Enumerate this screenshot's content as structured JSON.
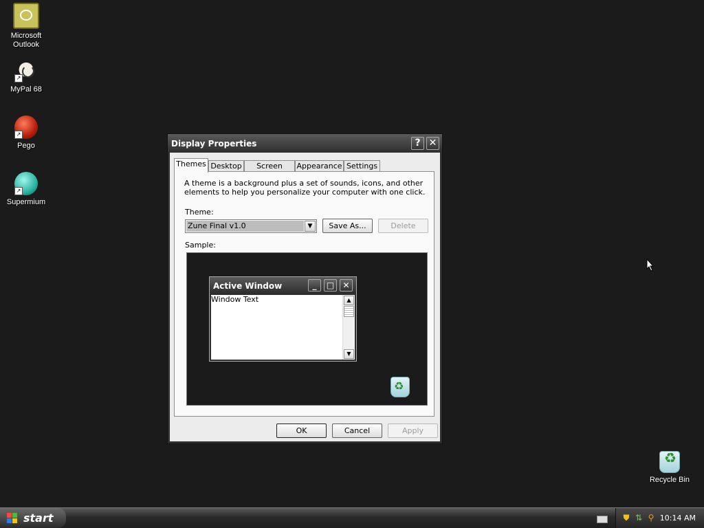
{
  "desktop": {
    "icons": [
      {
        "label": "Microsoft Outlook",
        "icon": "outlook-icon"
      },
      {
        "label": "MyPal 68",
        "icon": "mypal-icon"
      },
      {
        "label": "Pego",
        "icon": "pego-icon"
      },
      {
        "label": "Supermium",
        "icon": "supermium-icon"
      },
      {
        "label": "Recycle Bin",
        "icon": "recycle-bin-icon"
      }
    ]
  },
  "dialog": {
    "title": "Display Properties",
    "help_glyph": "?",
    "close_glyph": "✕",
    "tabs": [
      "Themes",
      "Desktop",
      "Screen Saver",
      "Appearance",
      "Settings"
    ],
    "active_tab": "Themes",
    "description": "A theme is a background plus a set of sounds, icons, and other elements to help you personalize your computer with one click.",
    "theme_label": "Theme:",
    "theme_value": "Zune Final v1.0",
    "save_as_label": "Save As...",
    "delete_label": "Delete",
    "sample_label": "Sample:",
    "sample": {
      "window_title": "Active Window",
      "window_text": "Window Text"
    },
    "ok_label": "OK",
    "cancel_label": "Cancel",
    "apply_label": "Apply"
  },
  "taskbar": {
    "start_label": "start",
    "clock": "10:14 AM"
  },
  "colors": {
    "desktop_background": "#1b1b1b",
    "title_bar": "#2e2e2e",
    "dialog_face": "#ececec"
  }
}
